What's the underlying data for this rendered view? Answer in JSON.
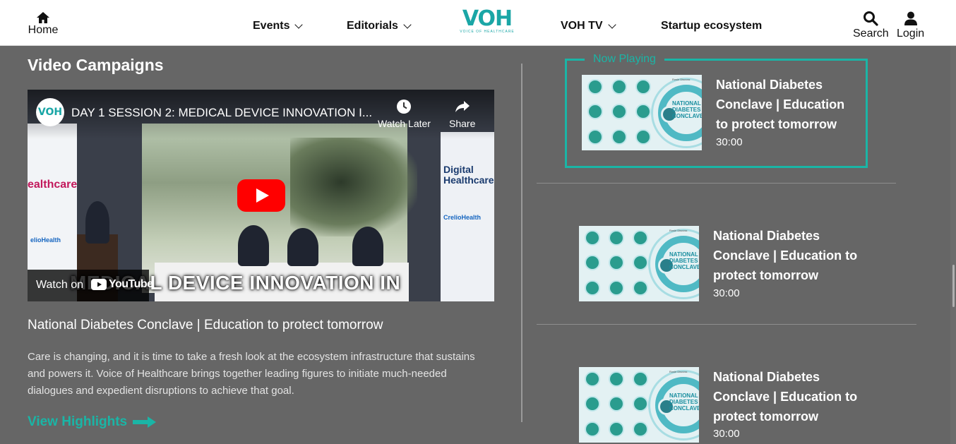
{
  "header": {
    "home_label": "Home",
    "nav": [
      {
        "label": "Events"
      },
      {
        "label": "Editorials"
      },
      {
        "label": "VOH TV"
      },
      {
        "label": "Startup ecosystem"
      }
    ],
    "logo_text": "VOH",
    "logo_sub": "VOICE OF HEALTHCARE",
    "search_label": "Search",
    "login_label": "Login"
  },
  "main": {
    "section_title": "Video Campaigns",
    "video": {
      "channel_avatar": "VOH",
      "title": "DAY 1 SESSION 2: MEDICAL DEVICE INNOVATION I...",
      "watch_later": "Watch Later",
      "share": "Share",
      "watch_on": "Watch on",
      "youtube": "YouTube",
      "caption": "MEDICAL DEVICE INNOVATION IN",
      "banner_left": "ealthcare",
      "banner_left_sponsor": "elioHealth",
      "banner_right": "Digital Healthcare",
      "banner_right_sponsor": "CrelioHealth"
    },
    "heading": "National Diabetes Conclave | Education to protect tomorrow",
    "description": "Care is changing, and it is time to take a fresh look at the ecosystem infrastructure that sustains and powers it. Voice of Healthcare brings together leading figures to initiate much-needed dialogues and expedient disruptions to achieve that goal.",
    "view_highlights": "View Highlights"
  },
  "playlist": {
    "now_playing_label": "Now Playing",
    "thumb_brand": "Rosie Discuss",
    "thumb_title": "NATIONAL DIABETES CONCLAVE",
    "items": [
      {
        "title": "National Diabetes Conclave | Education to protect tomorrow",
        "duration": "30:00"
      },
      {
        "title": "National Diabetes Conclave | Education to protect tomorrow",
        "duration": "30:00"
      },
      {
        "title": "National Diabetes Conclave | Education to protect tomorrow",
        "duration": "30:00"
      }
    ]
  },
  "colors": {
    "accent": "#1ab5a6",
    "background": "#666666",
    "header_bg": "#ffffff",
    "youtube_red": "#ff0000"
  },
  "icons": [
    "home-icon",
    "chevron-down-icon",
    "search-icon",
    "user-icon",
    "clock-icon",
    "share-icon",
    "play-icon",
    "youtube-icon",
    "arrow-right-icon"
  ]
}
